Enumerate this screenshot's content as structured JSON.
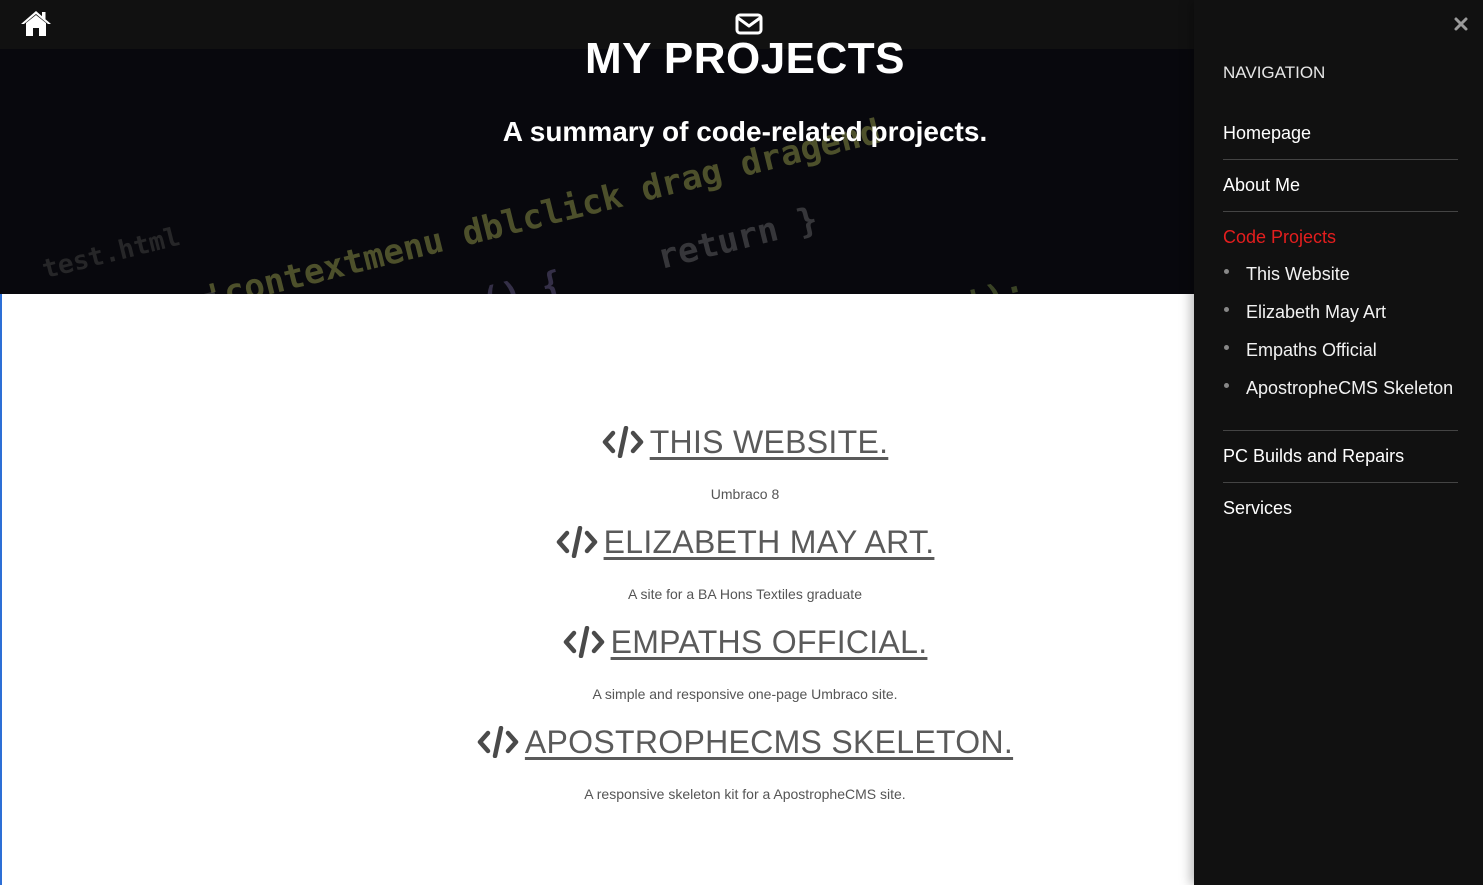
{
  "topbar": {
    "home_icon": "home-icon",
    "mail_icon": "envelope-icon"
  },
  "hero": {
    "title": "MY PROJECTS",
    "subtitle": "A summary of code-related projects."
  },
  "projects": [
    {
      "title": "THIS WEBSITE.",
      "description": "Umbraco 8",
      "icon": "code-icon"
    },
    {
      "title": "ELIZABETH MAY ART.",
      "description": "A site for a BA Hons Textiles graduate",
      "icon": "code-icon"
    },
    {
      "title": "EMPATHS OFFICIAL.",
      "description": "A simple and responsive one-page Umbraco site.",
      "icon": "code-icon"
    },
    {
      "title": "APOSTROPHECMS SKELETON.",
      "description": "A responsive skeleton kit for a ApostropheCMS site.",
      "icon": "code-icon"
    }
  ],
  "sidebar": {
    "close_icon": "close-icon",
    "heading": "NAVIGATION",
    "items": [
      {
        "label": "Homepage"
      },
      {
        "label": "About Me"
      },
      {
        "label": "Code Projects",
        "active": true,
        "children": [
          {
            "label": "This Website"
          },
          {
            "label": "Elizabeth May Art"
          },
          {
            "label": "Empaths Official"
          },
          {
            "label": "ApostropheCMS Skeleton"
          }
        ]
      },
      {
        "label": "PC Builds and Repairs"
      },
      {
        "label": "Services"
      }
    ]
  },
  "colors": {
    "topbar": "#111111",
    "sidebar": "#111111",
    "active_link": "#e41e1e",
    "project_text": "#5a5a5a"
  }
}
